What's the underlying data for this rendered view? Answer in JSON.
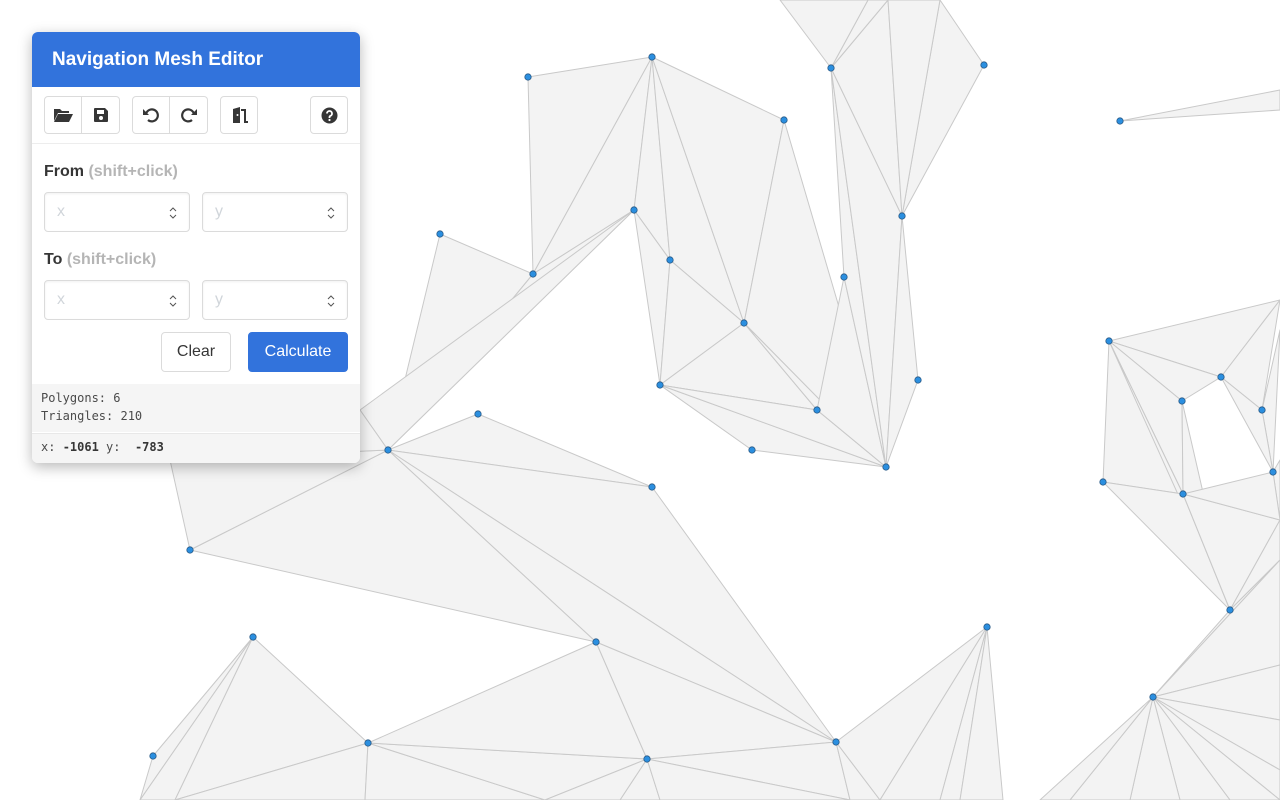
{
  "panel": {
    "title": "Navigation Mesh Editor",
    "toolbar": {
      "open_icon": "folder-open-icon",
      "save_icon": "save-icon",
      "undo_icon": "undo-icon",
      "redo_icon": "redo-icon",
      "exit_icon": "door-open-icon",
      "help_icon": "question-circle-icon"
    },
    "from": {
      "label": "From",
      "hint": "(shift+click)",
      "x_placeholder": "x",
      "y_placeholder": "y",
      "x_value": "",
      "y_value": ""
    },
    "to": {
      "label": "To",
      "hint": "(shift+click)",
      "x_placeholder": "x",
      "y_placeholder": "y",
      "x_value": "",
      "y_value": ""
    },
    "buttons": {
      "clear": "Clear",
      "calculate": "Calculate"
    },
    "stats": {
      "polygons_label": "Polygons:",
      "polygons": "6",
      "triangles_label": "Triangles:",
      "triangles": "210"
    },
    "cursor": {
      "x_label": "x:",
      "x": "-1061",
      "y_label": "y:",
      "y": "-783"
    }
  },
  "colors": {
    "accent": "#3273dc",
    "mesh_fill": "#f3f3f3",
    "mesh_edge": "#c9c9c9",
    "vertex": "#2b8fe0"
  }
}
